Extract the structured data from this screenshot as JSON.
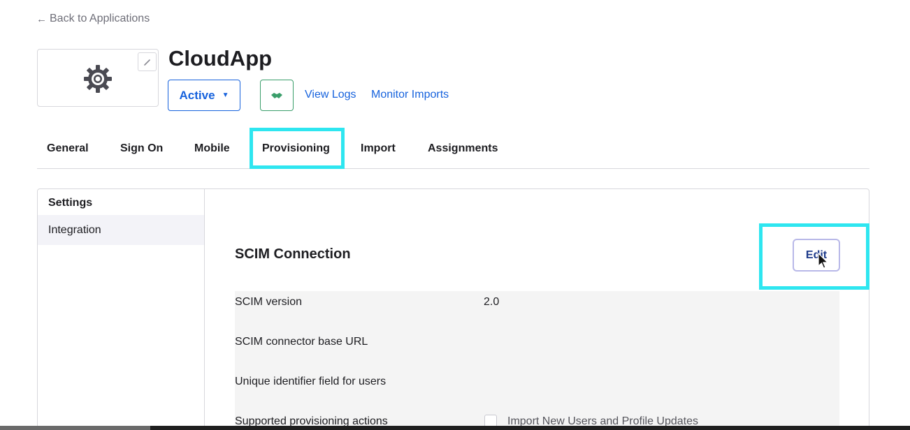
{
  "nav": {
    "back_label": "Back to Applications"
  },
  "app": {
    "name": "CloudApp",
    "status_label": "Active",
    "links": {
      "view_logs": "View Logs",
      "monitor_imports": "Monitor Imports"
    }
  },
  "tabs": [
    {
      "label": "General"
    },
    {
      "label": "Sign On"
    },
    {
      "label": "Mobile"
    },
    {
      "label": "Provisioning",
      "active": true
    },
    {
      "label": "Import"
    },
    {
      "label": "Assignments"
    }
  ],
  "sidebar": {
    "heading": "Settings",
    "items": [
      {
        "label": "Integration",
        "selected": true
      }
    ]
  },
  "section": {
    "title": "SCIM Connection",
    "edit_label": "Edit",
    "fields": [
      {
        "label": "SCIM version",
        "value": "2.0"
      },
      {
        "label": "SCIM connector base URL",
        "value": ""
      },
      {
        "label": "Unique identifier field for users",
        "value": ""
      },
      {
        "label": "Supported provisioning actions",
        "option": "Import New Users and Profile Updates",
        "checked": false
      }
    ]
  },
  "colors": {
    "accent_blue": "#1662dd",
    "highlight_cyan": "#2ee6f0",
    "handshake_green": "#3a9e6a"
  },
  "icons": {
    "back": "arrow-left-icon",
    "logo": "gear-icon",
    "logo_edit": "pencil-icon",
    "status_caret": "caret-down-icon",
    "handshake": "handshake-icon",
    "cursor": "mouse-pointer-icon"
  }
}
